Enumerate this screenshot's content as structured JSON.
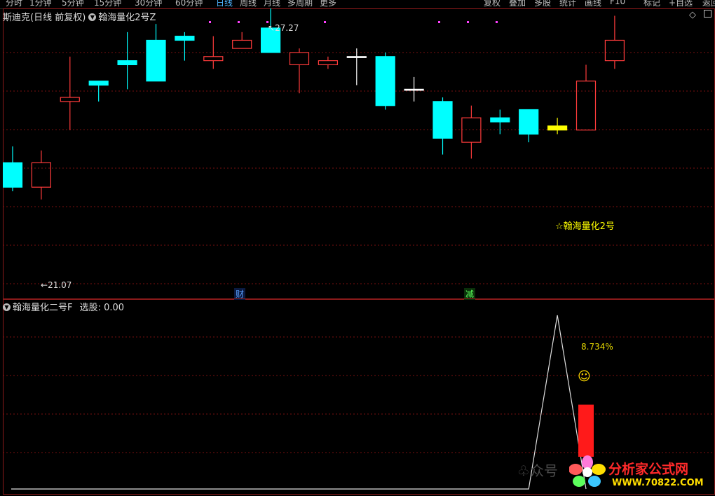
{
  "toolbar": {
    "left_items": [
      "分时",
      "1分钟",
      "5分钟",
      "15分钟",
      "30分钟",
      "60分钟",
      "日线",
      "周线",
      "月线",
      "多周期",
      "更多"
    ],
    "active_index": 6,
    "right_items": [
      "复权",
      "叠加",
      "多股",
      "统计",
      "画线",
      "F10",
      "标记",
      "+自选",
      "返回"
    ]
  },
  "main": {
    "title_stock": "斯迪克(日线 前复权)",
    "title_formula": "翰海量化2号Z",
    "high_label": "27.27",
    "low_label": "21.07",
    "signal_label": "☆翰海量化2号",
    "tag_cai": "财",
    "tag_jian": "减",
    "colors": {
      "up": "#ff3b3b",
      "down": "#00ffff",
      "doji": "#ffffff",
      "signal": "#ffff00",
      "grid": "#7a1010"
    }
  },
  "indicator": {
    "title_name": "翰海量化二号F",
    "title_value": "选股: 0.00",
    "percent_label": "8.734%",
    "smiley": "☺"
  },
  "watermark": {
    "wechat": "众号",
    "brand": "分析家公式网",
    "url": "WWW.70822.COM"
  },
  "chart_data": {
    "type": "candlestick",
    "candles": [
      {
        "o": 24.0,
        "h": 24.4,
        "l": 23.3,
        "c": 23.4,
        "dir": "down"
      },
      {
        "o": 23.4,
        "h": 24.3,
        "l": 23.1,
        "c": 24.0,
        "dir": "up"
      },
      {
        "o": 25.5,
        "h": 26.6,
        "l": 24.8,
        "c": 25.6,
        "dir": "up"
      },
      {
        "o": 25.9,
        "h": 26.0,
        "l": 25.5,
        "c": 26.0,
        "dir": "down"
      },
      {
        "o": 26.5,
        "h": 27.2,
        "l": 25.8,
        "c": 26.4,
        "dir": "down"
      },
      {
        "o": 27.0,
        "h": 27.4,
        "l": 26.0,
        "c": 26.0,
        "dir": "down"
      },
      {
        "o": 27.1,
        "h": 27.2,
        "l": 26.5,
        "c": 27.0,
        "dir": "down"
      },
      {
        "o": 26.6,
        "h": 27.1,
        "l": 26.3,
        "c": 26.5,
        "dir": "up"
      },
      {
        "o": 26.8,
        "h": 27.2,
        "l": 26.8,
        "c": 27.0,
        "dir": "up"
      },
      {
        "o": 26.7,
        "h": 27.8,
        "l": 26.8,
        "c": 27.3,
        "dir": "down"
      },
      {
        "o": 26.4,
        "h": 26.8,
        "l": 25.7,
        "c": 26.7,
        "dir": "up"
      },
      {
        "o": 26.5,
        "h": 26.6,
        "l": 26.3,
        "c": 26.4,
        "dir": "up"
      },
      {
        "o": 26.6,
        "h": 26.8,
        "l": 25.9,
        "c": 26.6,
        "dir": "doji"
      },
      {
        "o": 26.6,
        "h": 26.7,
        "l": 25.3,
        "c": 25.4,
        "dir": "down"
      },
      {
        "o": 25.8,
        "h": 26.1,
        "l": 25.5,
        "c": 25.8,
        "dir": "doji"
      },
      {
        "o": 25.5,
        "h": 25.6,
        "l": 24.2,
        "c": 24.6,
        "dir": "down"
      },
      {
        "o": 24.5,
        "h": 25.4,
        "l": 24.1,
        "c": 25.1,
        "dir": "up"
      },
      {
        "o": 25.1,
        "h": 25.3,
        "l": 24.7,
        "c": 25.0,
        "dir": "down"
      },
      {
        "o": 25.3,
        "h": 25.3,
        "l": 24.5,
        "c": 24.7,
        "dir": "down"
      },
      {
        "o": 24.8,
        "h": 25.1,
        "l": 24.7,
        "c": 24.9,
        "dir": "signal"
      },
      {
        "o": 24.8,
        "h": 26.4,
        "l": 24.8,
        "c": 26.0,
        "dir": "up"
      },
      {
        "o": 26.5,
        "h": 27.6,
        "l": 26.3,
        "c": 27.0,
        "dir": "up"
      }
    ],
    "ylim": [
      21.0,
      27.3
    ],
    "indicator": {
      "line_x_index": [
        0,
        18,
        19,
        20
      ],
      "line_values": [
        0,
        0,
        1,
        0
      ],
      "bar_value": 0.3
    }
  }
}
